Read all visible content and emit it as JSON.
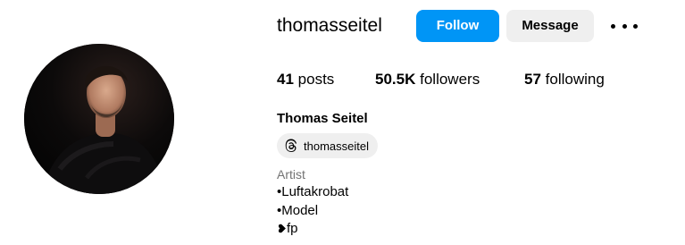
{
  "profile": {
    "username": "thomasseitel",
    "full_name": "Thomas Seitel",
    "category": "Artist",
    "threads_handle": "thomasseitel",
    "avatar_icon": "profile-photo"
  },
  "actions": {
    "follow_label": "Follow",
    "message_label": "Message",
    "more_icon": "more-options-icon",
    "follow_color": "#0095f6"
  },
  "stats": [
    {
      "count": "41",
      "label": "posts"
    },
    {
      "count": "50.5K",
      "label": "followers"
    },
    {
      "count": "57",
      "label": "following"
    }
  ],
  "bio": {
    "lines": [
      "•Luftakrobat",
      "•Model"
    ],
    "last_line_text": "fp",
    "last_line_icon": "black-heart-icon"
  }
}
